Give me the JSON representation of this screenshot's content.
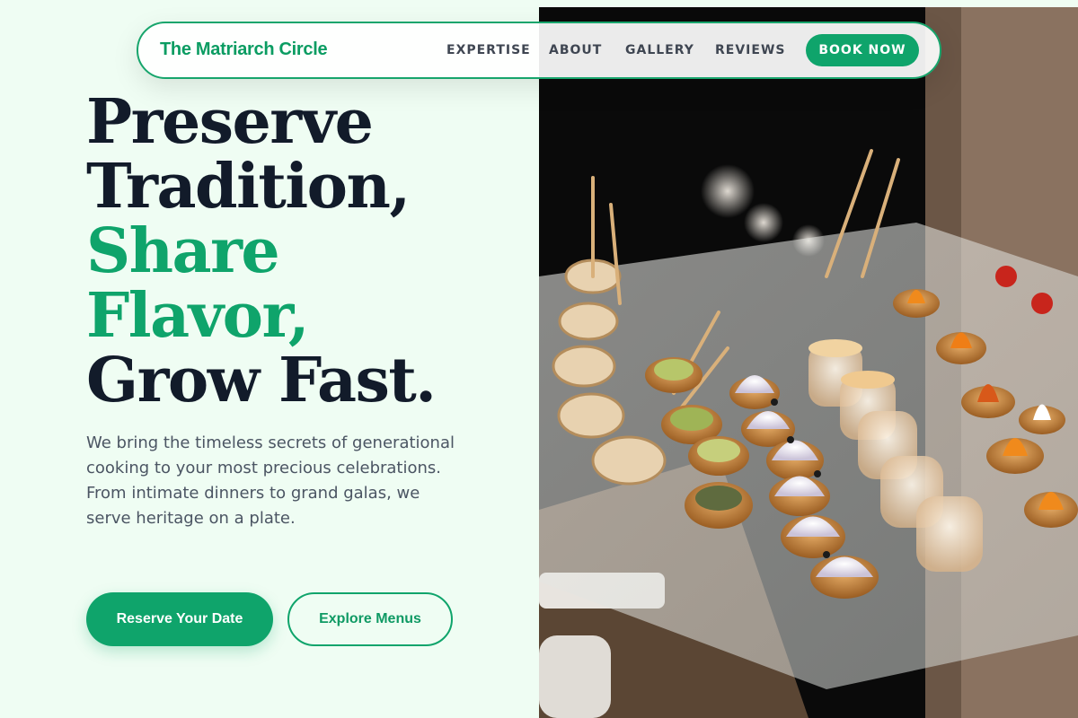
{
  "brand": {
    "name": "The Matriarch Circle"
  },
  "nav": {
    "links": [
      "EXPERTISE",
      "ABOUT",
      "GALLERY",
      "REVIEWS"
    ],
    "cta_label": "BOOK NOW"
  },
  "hero": {
    "headline": {
      "line1": "Preserve",
      "line2": "Tradition,",
      "line3": "Share",
      "line4": "Flavor,",
      "line5": "Grow Fast."
    },
    "description": "We bring the timeless secrets of generational cooking to your most precious celebrations. From intimate dinners to grand galas, we serve heritage on a plate.",
    "primary_cta": "Reserve Your Date",
    "secondary_cta": "Explore Menus"
  },
  "colors": {
    "accent": "#0fa46b",
    "headline": "#121b2a",
    "background": "#effdf3"
  }
}
